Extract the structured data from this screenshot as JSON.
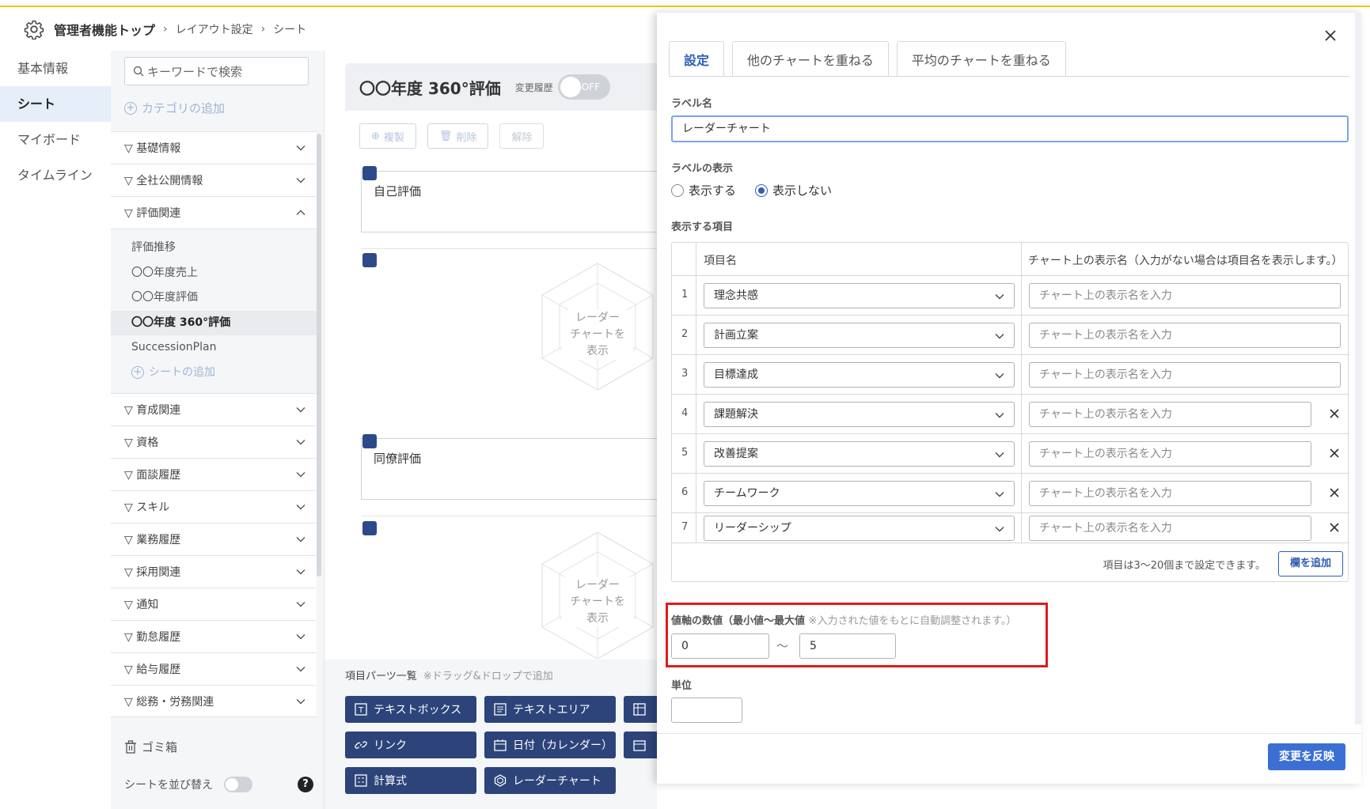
{
  "header": {
    "crumb_root": "管理者機能トップ",
    "crumb_layout": "レイアウト設定",
    "crumb_sheet": "シート"
  },
  "leftnav": {
    "items": [
      {
        "label": "基本情報"
      },
      {
        "label": "シート"
      },
      {
        "label": "マイボード"
      },
      {
        "label": "タイムライン"
      }
    ]
  },
  "categories": {
    "search_placeholder": "キーワードで検索",
    "add_category": "カテゴリの追加",
    "items": [
      {
        "label": "▽ 基礎情報"
      },
      {
        "label": "▽ 全社公開情報"
      },
      {
        "label": "▽ 評価関連"
      },
      {
        "label": "▽ 育成関連"
      },
      {
        "label": "▽ 資格"
      },
      {
        "label": "▽ 面談履歴"
      },
      {
        "label": "▽ スキル"
      },
      {
        "label": "▽ 業務履歴"
      },
      {
        "label": "▽ 採用関連"
      },
      {
        "label": "▽ 通知"
      },
      {
        "label": "▽ 勤怠履歴"
      },
      {
        "label": "▽ 給与履歴"
      },
      {
        "label": "▽ 総務・労務関連"
      }
    ],
    "sub_items": [
      {
        "label": "評価推移"
      },
      {
        "label": "〇〇年度売上"
      },
      {
        "label": "〇〇年度評価"
      },
      {
        "label": "〇〇年度 360°評価"
      },
      {
        "label": "SuccessionPlan"
      }
    ],
    "add_sheet": "シートの追加",
    "trash": "ゴミ箱",
    "sort_label": "シートを並び替え",
    "help": "?"
  },
  "main": {
    "sheet_title": "〇〇年度 360°評価",
    "history_label": "変更履歴",
    "history_toggle": "OFF",
    "btn_copy": "複製",
    "btn_delete": "削除",
    "btn_release": "解除",
    "card1_label": "自己評価",
    "card2_label": "同僚評価",
    "radar_text_1": "レーダー",
    "radar_text_2": "チャートを",
    "radar_text_3": "表示",
    "parts_title": "項目パーツ一覧",
    "parts_hint": "※ドラッグ&ドロップで追加",
    "parts": {
      "textbox": "テキストボックス",
      "textarea": "テキストエリア",
      "link": "リンク",
      "date": "日付（カレンダー）",
      "formula": "計算式",
      "radar": "レーダーチャート"
    }
  },
  "panel": {
    "tabs": [
      {
        "label": "設定"
      },
      {
        "label": "他のチャートを重ねる"
      },
      {
        "label": "平均のチャートを重ねる"
      }
    ],
    "label_name_title": "ラベル名",
    "label_name_value": "レーダーチャート",
    "label_display_title": "ラベルの表示",
    "radio_show": "表示する",
    "radio_hide": "表示しない",
    "items_title": "表示する項目",
    "col_item": "項目名",
    "col_display": "チャート上の表示名（入力がない場合は項目名を表示します。）",
    "display_placeholder": "チャート上の表示名を入力",
    "rows": [
      {
        "num": "1",
        "item": "理念共感"
      },
      {
        "num": "2",
        "item": "計画立案"
      },
      {
        "num": "3",
        "item": "目標達成"
      },
      {
        "num": "4",
        "item": "課題解決"
      },
      {
        "num": "5",
        "item": "改善提案"
      },
      {
        "num": "6",
        "item": "チームワーク"
      },
      {
        "num": "7",
        "item": "リーダーシップ"
      }
    ],
    "items_note": "項目は3〜20個まで設定できます。",
    "add_column": "欄を追加",
    "axis_title": "値軸の数値（最小値〜最大値",
    "axis_note": "※入力された値をもとに自動調整されます。）",
    "axis_min": "0",
    "axis_tilde": "〜",
    "axis_max": "5",
    "unit_title": "単位",
    "apply": "変更を反映"
  }
}
